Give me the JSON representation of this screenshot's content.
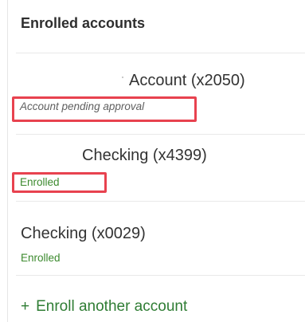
{
  "panel": {
    "title": "Enrolled accounts"
  },
  "accounts": [
    {
      "name": "Account (x2050)",
      "status": "Account pending approval"
    },
    {
      "name": "Checking (x4399)",
      "status": "Enrolled"
    },
    {
      "name": "Checking (x0029)",
      "status": "Enrolled"
    }
  ],
  "footer": {
    "plus_glyph": "+",
    "enroll_label": "Enroll another account"
  },
  "colors": {
    "highlight": "#e8424f",
    "enrolled_status": "#3c8a2e",
    "link": "#2f7d34"
  },
  "icons": {
    "add": "plus-icon"
  }
}
